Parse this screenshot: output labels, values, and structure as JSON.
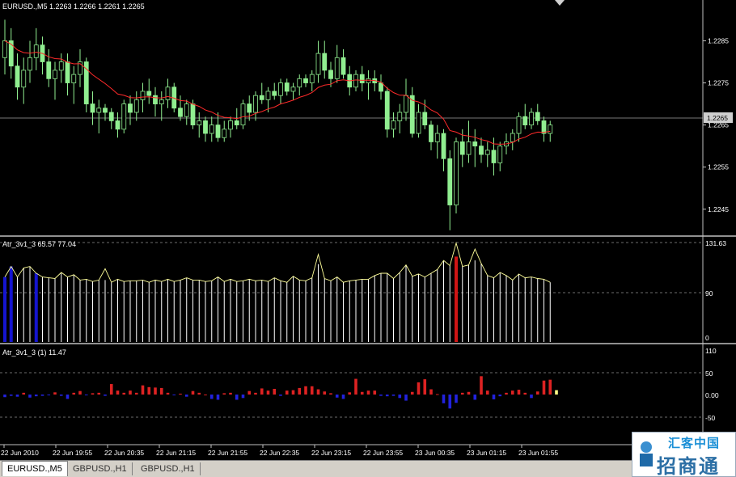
{
  "main_chart": {
    "label": "EURUSD.,M5  1.2263 1.2266 1.2261 1.2265",
    "price_ticks": [
      "1.2285",
      "1.2275",
      "1.2265",
      "1.2255",
      "1.2245"
    ],
    "current_price": "1.2265",
    "colors": {
      "bull": "#90ee90",
      "bear": "#90ee90",
      "ma": "#ff3030",
      "price_line": "#b0b0b0"
    }
  },
  "indicator1": {
    "label": "Atr_3v1_3 65.57 77.04",
    "ticks": [
      "131.63",
      "90",
      "0"
    ],
    "colors": {
      "bar": "#ffffff",
      "line": "#ffff99",
      "blue": "#1515d0",
      "red": "#d01515"
    }
  },
  "indicator2": {
    "label": "Atr_3v1_3 (1) 11.47",
    "ticks": [
      "110",
      "50",
      "0.00",
      "-50"
    ],
    "colors": {
      "pos": "#dd2222",
      "neg": "#2222dd",
      "last": "#ffff88"
    }
  },
  "time_axis": {
    "labels": [
      "22 Jun 2010",
      "22 Jun 19:55",
      "22 Jun 20:35",
      "22 Jun 21:15",
      "22 Jun 21:55",
      "22 Jun 22:35",
      "22 Jun 23:15",
      "22 Jun 23:55",
      "23 Jun 00:35",
      "23 Jun 01:15",
      "23 Jun 01:55"
    ]
  },
  "tabs": [
    {
      "label": "EURUSD.,M5",
      "active": true
    },
    {
      "label": "GBPUSD.,H1",
      "active": false
    },
    {
      "label": "GBPUSD.,H1",
      "active": false
    }
  ],
  "watermark": {
    "line1": "汇客中国",
    "line2": "招商通"
  },
  "chart_data": {
    "type": "candlestick",
    "symbol": "EURUSD.",
    "timeframe": "M5",
    "ylim": [
      1.2239,
      1.2292
    ],
    "candles": [
      [
        1.2281,
        1.229,
        1.2277,
        1.2285
      ],
      [
        1.2285,
        1.2288,
        1.2276,
        1.2279
      ],
      [
        1.2279,
        1.2282,
        1.2271,
        1.2274
      ],
      [
        1.2274,
        1.2281,
        1.227,
        1.2278
      ],
      [
        1.2278,
        1.2285,
        1.2275,
        1.2281
      ],
      [
        1.2281,
        1.2288,
        1.2278,
        1.2284
      ],
      [
        1.2284,
        1.2286,
        1.2277,
        1.228
      ],
      [
        1.228,
        1.2283,
        1.2274,
        1.2276
      ],
      [
        1.2276,
        1.228,
        1.2271,
        1.2278
      ],
      [
        1.2278,
        1.2282,
        1.2275,
        1.228
      ],
      [
        1.228,
        1.2282,
        1.2272,
        1.2275
      ],
      [
        1.2275,
        1.2279,
        1.227,
        1.2277
      ],
      [
        1.2277,
        1.2283,
        1.2274,
        1.228
      ],
      [
        1.228,
        1.2281,
        1.2268,
        1.227
      ],
      [
        1.227,
        1.2273,
        1.2265,
        1.2268
      ],
      [
        1.2268,
        1.2271,
        1.2263,
        1.2269
      ],
      [
        1.2269,
        1.227,
        1.2266,
        1.2268
      ],
      [
        1.2268,
        1.2269,
        1.2264,
        1.2266
      ],
      [
        1.2266,
        1.2268,
        1.2262,
        1.2264
      ],
      [
        1.2264,
        1.2271,
        1.2263,
        1.227
      ],
      [
        1.227,
        1.2272,
        1.2265,
        1.2268
      ],
      [
        1.2268,
        1.2273,
        1.2266,
        1.2271
      ],
      [
        1.2271,
        1.2275,
        1.2268,
        1.2273
      ],
      [
        1.2273,
        1.2276,
        1.227,
        1.2272
      ],
      [
        1.2272,
        1.2274,
        1.2267,
        1.227
      ],
      [
        1.227,
        1.2273,
        1.2266,
        1.2271
      ],
      [
        1.2271,
        1.2276,
        1.2269,
        1.2274
      ],
      [
        1.2274,
        1.2275,
        1.2268,
        1.2269
      ],
      [
        1.2269,
        1.2272,
        1.2266,
        1.2267
      ],
      [
        1.2267,
        1.2271,
        1.2265,
        1.227
      ],
      [
        1.227,
        1.2271,
        1.2264,
        1.2265
      ],
      [
        1.2265,
        1.2268,
        1.2262,
        1.2266
      ],
      [
        1.2266,
        1.2267,
        1.2261,
        1.2263
      ],
      [
        1.2263,
        1.2267,
        1.2261,
        1.2265
      ],
      [
        1.2265,
        1.2268,
        1.2261,
        1.2262
      ],
      [
        1.2262,
        1.2266,
        1.2261,
        1.2264
      ],
      [
        1.2264,
        1.2267,
        1.2262,
        1.2266
      ],
      [
        1.2266,
        1.2269,
        1.2264,
        1.2265
      ],
      [
        1.2265,
        1.2271,
        1.2264,
        1.227
      ],
      [
        1.227,
        1.2272,
        1.2266,
        1.2268
      ],
      [
        1.2268,
        1.2273,
        1.2266,
        1.2272
      ],
      [
        1.2272,
        1.2275,
        1.227,
        1.2271
      ],
      [
        1.2271,
        1.2274,
        1.2268,
        1.2273
      ],
      [
        1.2273,
        1.2275,
        1.2271,
        1.2272
      ],
      [
        1.2272,
        1.2276,
        1.227,
        1.2275
      ],
      [
        1.2275,
        1.2276,
        1.2272,
        1.2273
      ],
      [
        1.2273,
        1.2275,
        1.2271,
        1.2274
      ],
      [
        1.2274,
        1.2277,
        1.2272,
        1.2276
      ],
      [
        1.2276,
        1.2277,
        1.2274,
        1.2275
      ],
      [
        1.2275,
        1.2278,
        1.2273,
        1.2277
      ],
      [
        1.2277,
        1.2285,
        1.2275,
        1.2282
      ],
      [
        1.2282,
        1.2285,
        1.2276,
        1.2278
      ],
      [
        1.2278,
        1.228,
        1.2274,
        1.2276
      ],
      [
        1.2276,
        1.2284,
        1.2275,
        1.2281
      ],
      [
        1.2281,
        1.2283,
        1.2276,
        1.2277
      ],
      [
        1.2277,
        1.2279,
        1.2272,
        1.2274
      ],
      [
        1.2274,
        1.2278,
        1.2273,
        1.2277
      ],
      [
        1.2277,
        1.2279,
        1.2273,
        1.2275
      ],
      [
        1.2275,
        1.2278,
        1.2271,
        1.2276
      ],
      [
        1.2276,
        1.2278,
        1.2273,
        1.2275
      ],
      [
        1.2275,
        1.2277,
        1.2271,
        1.2273
      ],
      [
        1.2273,
        1.2274,
        1.2262,
        1.2264
      ],
      [
        1.2264,
        1.2268,
        1.2262,
        1.2266
      ],
      [
        1.2266,
        1.227,
        1.2263,
        1.2268
      ],
      [
        1.2268,
        1.2276,
        1.2266,
        1.2272
      ],
      [
        1.2272,
        1.2274,
        1.2262,
        1.2263
      ],
      [
        1.2263,
        1.227,
        1.2262,
        1.2268
      ],
      [
        1.2268,
        1.2271,
        1.2264,
        1.2265
      ],
      [
        1.2265,
        1.2266,
        1.2259,
        1.2261
      ],
      [
        1.2261,
        1.2265,
        1.2257,
        1.2263
      ],
      [
        1.2263,
        1.2264,
        1.2254,
        1.2257
      ],
      [
        1.2257,
        1.2259,
        1.224,
        1.2246
      ],
      [
        1.2246,
        1.2262,
        1.2244,
        1.2261
      ],
      [
        1.2261,
        1.2264,
        1.2255,
        1.2258
      ],
      [
        1.2258,
        1.2266,
        1.2256,
        1.2261
      ],
      [
        1.2261,
        1.2264,
        1.2255,
        1.226
      ],
      [
        1.226,
        1.2262,
        1.2256,
        1.2258
      ],
      [
        1.2258,
        1.2261,
        1.2255,
        1.2259
      ],
      [
        1.2259,
        1.2262,
        1.2253,
        1.2256
      ],
      [
        1.2256,
        1.2261,
        1.2254,
        1.226
      ],
      [
        1.226,
        1.2263,
        1.2258,
        1.2261
      ],
      [
        1.2261,
        1.2264,
        1.2259,
        1.2263
      ],
      [
        1.2263,
        1.2268,
        1.2261,
        1.2267
      ],
      [
        1.2267,
        1.227,
        1.2264,
        1.2265
      ],
      [
        1.2265,
        1.2269,
        1.2264,
        1.2268
      ],
      [
        1.2268,
        1.227,
        1.2265,
        1.2266
      ],
      [
        1.2266,
        1.2267,
        1.2261,
        1.2263
      ],
      [
        1.2263,
        1.2266,
        1.2261,
        1.2265
      ]
    ],
    "ma_label": "",
    "atr_bars": [
      86,
      100,
      86,
      98,
      100,
      91,
      86,
      85,
      84,
      92,
      86,
      89,
      82,
      83,
      80,
      82,
      82,
      79,
      83,
      80,
      81,
      81,
      82,
      79,
      82,
      80,
      83,
      80,
      82,
      85,
      82,
      82,
      80,
      81,
      86,
      80,
      83,
      80,
      81,
      83,
      81,
      82,
      80,
      85,
      81,
      79,
      87,
      82,
      81,
      85,
      103,
      84,
      81,
      86,
      79,
      81,
      82,
      83,
      83,
      88,
      91,
      91,
      84,
      92,
      102,
      87,
      90,
      86,
      91,
      96,
      108,
      101,
      113,
      100,
      102,
      108,
      104,
      88,
      85,
      92,
      88,
      82,
      90,
      85,
      86,
      84,
      83,
      79
    ],
    "atr_line": [
      86,
      100,
      86,
      98,
      100,
      91,
      86,
      85,
      84,
      92,
      86,
      89,
      82,
      83,
      80,
      82,
      97,
      79,
      83,
      80,
      81,
      81,
      82,
      79,
      82,
      80,
      83,
      80,
      82,
      85,
      82,
      82,
      80,
      81,
      86,
      80,
      83,
      80,
      81,
      83,
      81,
      82,
      80,
      85,
      81,
      79,
      87,
      82,
      81,
      85,
      116,
      84,
      81,
      86,
      79,
      81,
      82,
      83,
      83,
      88,
      91,
      91,
      84,
      92,
      102,
      87,
      90,
      86,
      91,
      96,
      108,
      101,
      131,
      100,
      102,
      123,
      104,
      88,
      85,
      92,
      88,
      82,
      90,
      85,
      86,
      84,
      83,
      79
    ],
    "atr_blue_index": [
      0,
      1,
      5
    ],
    "atr_red_index": [
      72
    ],
    "osc": [
      -6,
      -3,
      -5,
      4,
      -7,
      -4,
      -3,
      -1,
      5,
      -3,
      -10,
      4,
      8,
      -1,
      3,
      4,
      -3,
      24,
      9,
      4,
      9,
      4,
      21,
      17,
      16,
      15,
      4,
      -1,
      2,
      -5,
      8,
      4,
      0,
      -10,
      -12,
      3,
      4,
      -12,
      -8,
      8,
      4,
      14,
      9,
      13,
      -3,
      9,
      10,
      15,
      19,
      19,
      12,
      7,
      3,
      -7,
      -10,
      5,
      36,
      6,
      9,
      9,
      -3,
      -4,
      -3,
      -8,
      -14,
      6,
      28,
      35,
      12,
      1,
      -20,
      -32,
      -19,
      4,
      6,
      -12,
      42,
      9,
      -11,
      -4,
      4,
      9,
      11,
      4,
      -8,
      7,
      32,
      34,
      10
    ]
  }
}
